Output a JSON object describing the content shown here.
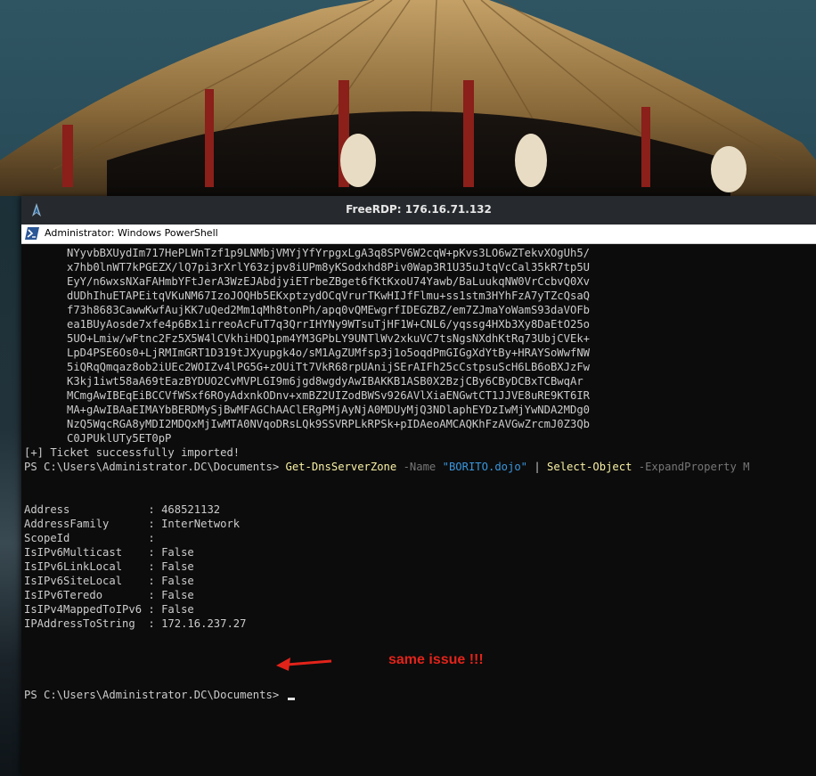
{
  "rdp": {
    "title": "FreeRDP: 176.16.71.132"
  },
  "powershell": {
    "title": "Administrator: Windows PowerShell"
  },
  "ticket_lines": [
    "NYyvbBXUydIm717HePLWnTzf1p9LNMbjVMYjYfYrpgxLgA3q8SPV6W2cqW+pKvs3LO6wZTekvXOgUh5/",
    "x7hb0lnWT7kPGEZX/lQ7pi3rXrlY63zjpv8iUPm8yKSodxhd8Piv0Wap3R1U35uJtqVcCal35kR7tp5U",
    "EyY/n6wxsNXaFAHmbYFtJerA3WzEJAbdjyiETrbeZBget6fKtKxoU74Yawb/BaLuukqNW0VrCcbvQ0Xv",
    "dUDhIhuETAPEitqVKuNM67IzoJOQHb5EKxptzydOCqVrurTKwHIJfFlmu+ss1stm3HYhFzA7yTZcQsaQ",
    "f73h8683CawwKwfAujKK7uQed2Mm1qMh8tonPh/apq0vQMEwgrfIDEGZBZ/em7ZJmaYoWamS93daVOFb",
    "ea1BUyAosde7xfe4p6Bx1irreoAcFuT7q3QrrIHYNy9WTsuTjHF1W+CNL6/yqssg4HXb3Xy8DaEtO25o",
    "5UO+Lmiw/wFtnc2Fz5X5W4lCVkhiHDQ1pm4YM3GPbLY9UNTlWv2xkuVC7tsNgsNXdhKtRq73UbjCVEk+",
    "LpD4PSE6Os0+LjRMImGRT1D319tJXyupgk4o/sM1AgZUMfsp3j1o5oqdPmGIGgXdYtBy+HRAYSoWwfNW",
    "5iQRqQmqaz8ob2iUEc2WOIZv4lPG5G+zOUiTt7VkR68rpUAnijSErAIFh25cCstpsuScH6LB6oBXJzFw",
    "K3kj1iwt58aA69tEazBYDUO2CvMVPLGI9m6jgd8wgdyAwIBAKKB1ASB0X2BzjCBy6CByDCBxTCBwqAr",
    "MCmgAwIBEqEiBCCVfWSxf6ROyAdxnkODnv+xmBZ2UIZodBWSv926AVlXiaENGwtCT1JJVE8uRE9KT6IR",
    "MA+gAwIBAaEIMAYbBERDMySjBwMFAGChAAClERgPMjAyNjA0MDUyMjQ3NDlaphEYDzIwMjYwNDA2MDg0",
    "NzQ5WqcRGA8yMDI2MDQxMjIwMTA0NVqoDRsLQk9SSVRPLkRPSk+pIDAeoAMCAQKhFzAVGwZrcmJ0Z3Qb",
    "C0JPUklUTy5ET0pP"
  ],
  "import_message": "[+] Ticket successfully imported!",
  "command": {
    "prompt": "PS C:\\Users\\Administrator.DC\\Documents> ",
    "cmdlet": "Get-DnsServerZone",
    "param_name": " -Name ",
    "param_value": "\"BORITO.dojo\"",
    "pipe": " | ",
    "cmdlet2": "Select-Object",
    "param2": " -ExpandProperty M"
  },
  "output": [
    "Address            : 468521132",
    "AddressFamily      : InterNetwork",
    "ScopeId            :",
    "IsIPv6Multicast    : False",
    "IsIPv6LinkLocal    : False",
    "IsIPv6SiteLocal    : False",
    "IsIPv6Teredo       : False",
    "IsIPv4MappedToIPv6 : False",
    "IPAddressToString  : 172.16.237.27"
  ],
  "final_prompt": "PS C:\\Users\\Administrator.DC\\Documents> ",
  "annotation": {
    "text": "same issue !!!",
    "color": "#e2231a"
  },
  "colors": {
    "console_bg": "#0c0c0c",
    "console_text": "#cccccc",
    "cmdlet": "#f9f1a5",
    "string": "#3a96dd",
    "param": "#767676"
  },
  "icons": {
    "rdp_logo": "freerdp-logo-icon",
    "ps_icon": "powershell-icon"
  }
}
